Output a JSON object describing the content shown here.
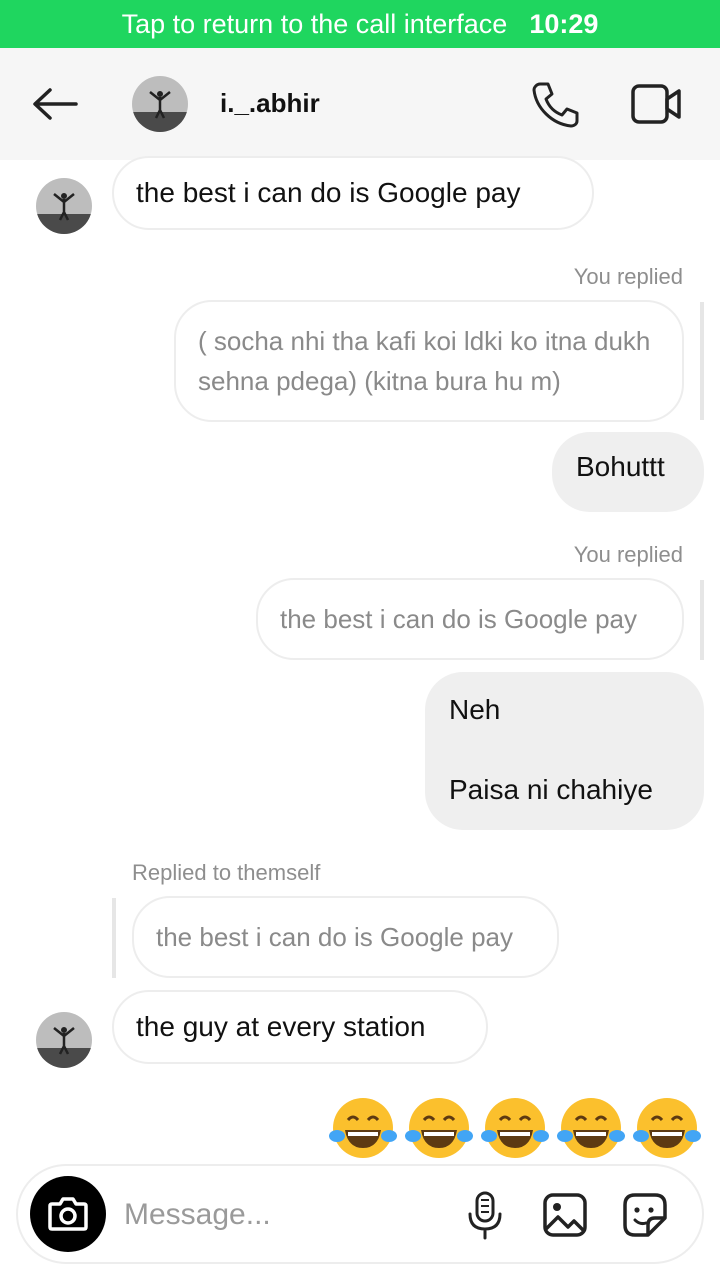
{
  "call_banner": {
    "text": "Tap to return to the call interface",
    "time": "10:29"
  },
  "header": {
    "username": "i._.abhir",
    "back": "back-arrow",
    "call": "phone-icon",
    "video": "video-camera-icon"
  },
  "messages": {
    "m1": {
      "text": "the best i can do is Google pay"
    },
    "m2": {
      "label": "You replied",
      "quote": "( socha nhi tha kafi koi ldki ko itna dukh sehna pdega) (kitna bura hu m)",
      "text": "Bohuttt"
    },
    "m3": {
      "label": "You replied",
      "quote": "the best i can do is Google pay",
      "line1": "Neh",
      "line2": "Paisa ni chahiye"
    },
    "m4": {
      "label": "Replied to themself",
      "quote": "the best i can do is Google pay",
      "text": "the guy at every station"
    },
    "m5": {
      "emojis": "😂😂😂😂😂"
    }
  },
  "composer": {
    "placeholder": "Message...",
    "icons": [
      "camera-icon",
      "microphone-icon",
      "gallery-icon",
      "sticker-icon"
    ]
  },
  "colors": {
    "call_banner": "#1fd65f",
    "outgoing_bubble": "#efefef",
    "header_bg": "#f6f6f6"
  }
}
